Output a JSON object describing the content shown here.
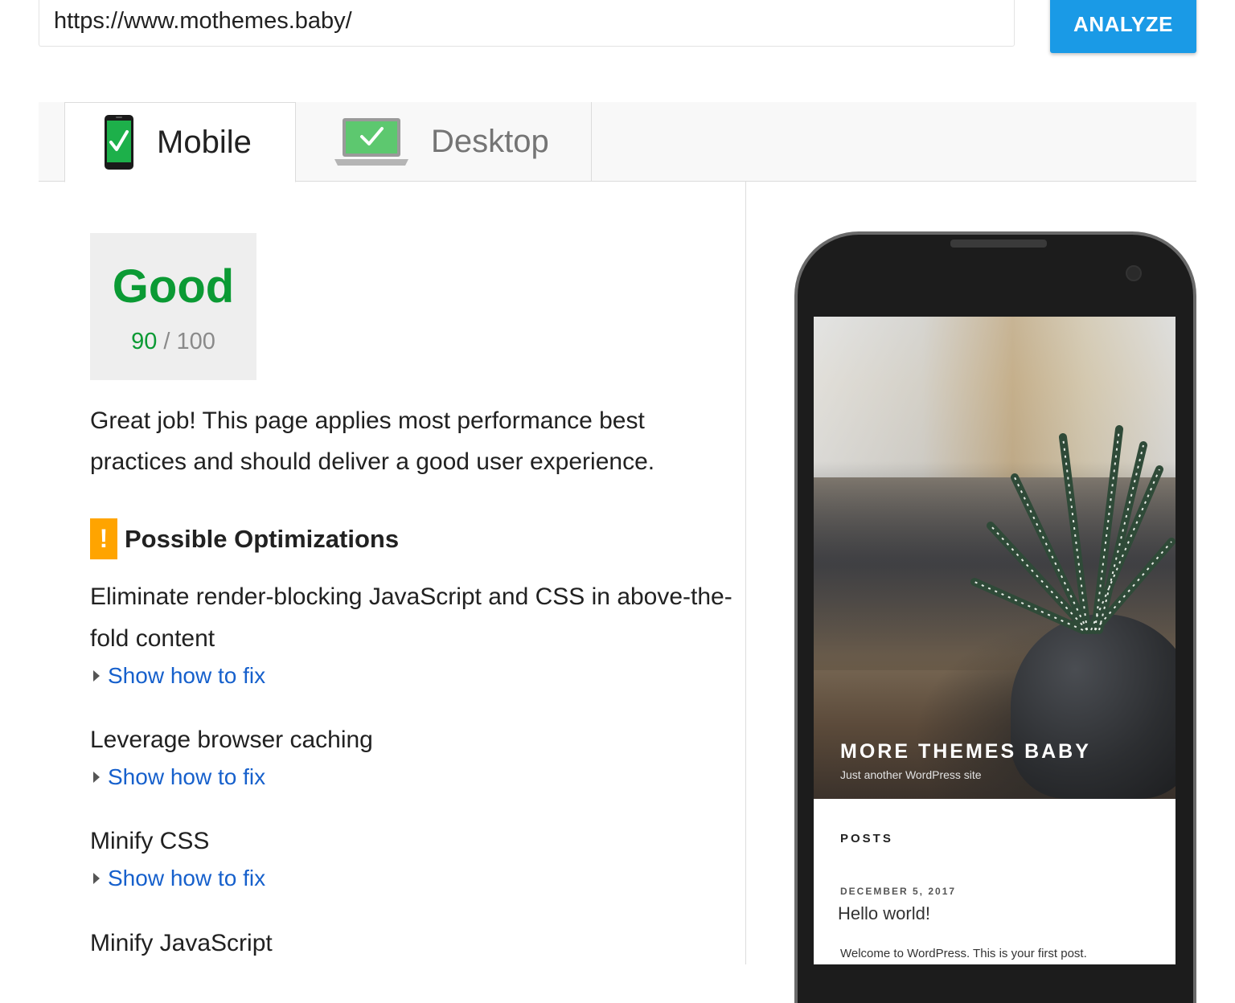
{
  "search": {
    "url_value": "https://www.mothemes.baby/",
    "analyze_label": "ANALYZE"
  },
  "tabs": [
    {
      "label": "Mobile",
      "icon": "mobile-check-icon",
      "selected": true
    },
    {
      "label": "Desktop",
      "icon": "desktop-check-icon",
      "selected": false
    }
  ],
  "score": {
    "rating": "Good",
    "value": "90",
    "separator": " / ",
    "max": "100",
    "color": "#0b9a34"
  },
  "summary": "Great job! This page applies most performance best practices and should deliver a good user experience.",
  "optimizations": {
    "badge": "!",
    "title": "Possible Optimizations",
    "items": [
      {
        "title": "Eliminate render-blocking JavaScript and CSS in above-the-fold content",
        "link": "Show how to fix"
      },
      {
        "title": "Leverage browser caching",
        "link": "Show how to fix"
      },
      {
        "title": "Minify CSS",
        "link": "Show how to fix"
      },
      {
        "title": "Minify JavaScript"
      }
    ]
  },
  "preview": {
    "site_title": "MORE THEMES BABY",
    "site_tagline": "Just another WordPress site",
    "posts_label": "POSTS",
    "post_date": "DECEMBER 5, 2017",
    "post_title": "Hello world!",
    "post_excerpt": "Welcome to WordPress. This is your first post."
  },
  "colors": {
    "accent": "#1a9ae6",
    "good": "#0b9a34",
    "warning": "#ffa400",
    "link": "#1660cc"
  }
}
